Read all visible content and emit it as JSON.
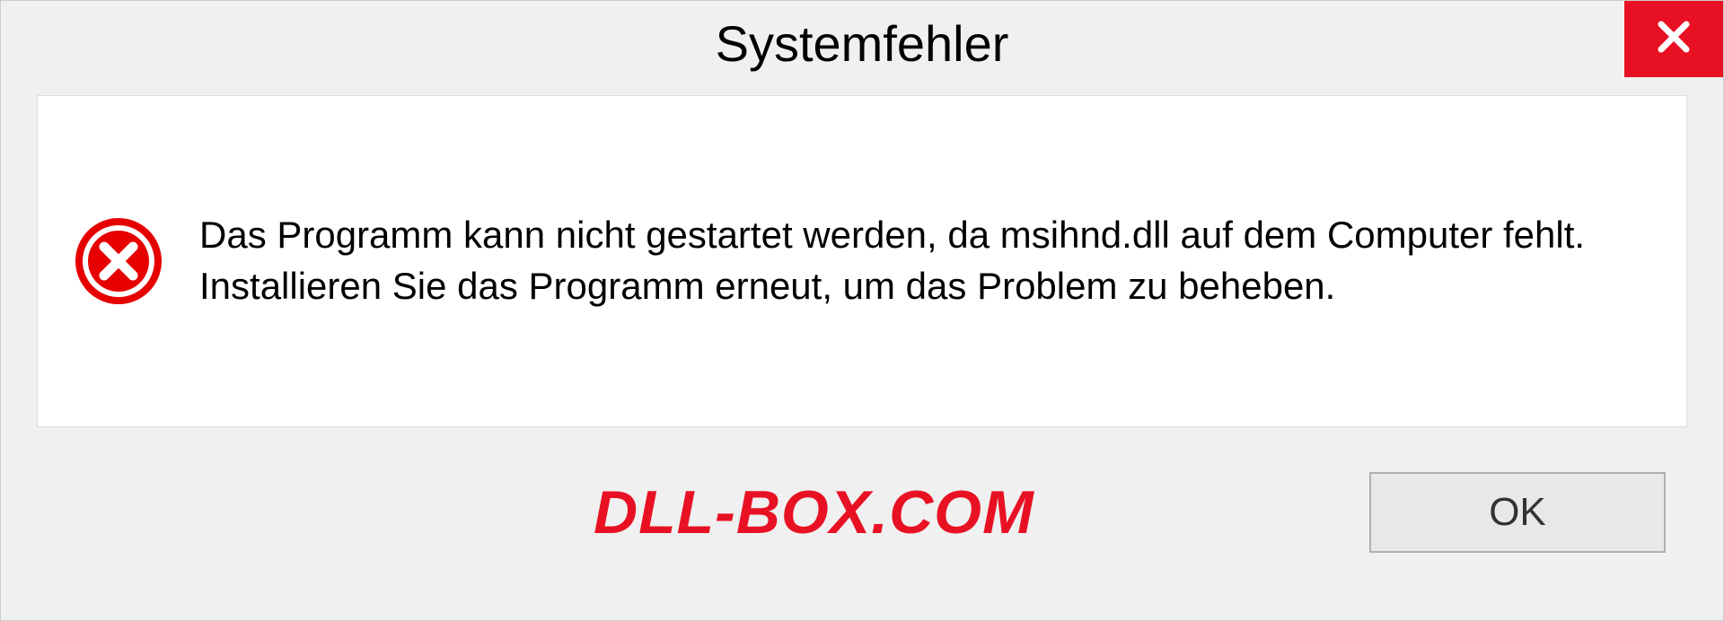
{
  "dialog": {
    "title": "Systemfehler",
    "message": "Das Programm kann nicht gestartet werden, da msihnd.dll auf dem Computer fehlt. Installieren Sie das Programm erneut, um das Problem zu beheben.",
    "ok_label": "OK"
  },
  "watermark": "DLL-BOX.COM",
  "colors": {
    "error_red": "#e81123",
    "close_red": "#e81123"
  }
}
